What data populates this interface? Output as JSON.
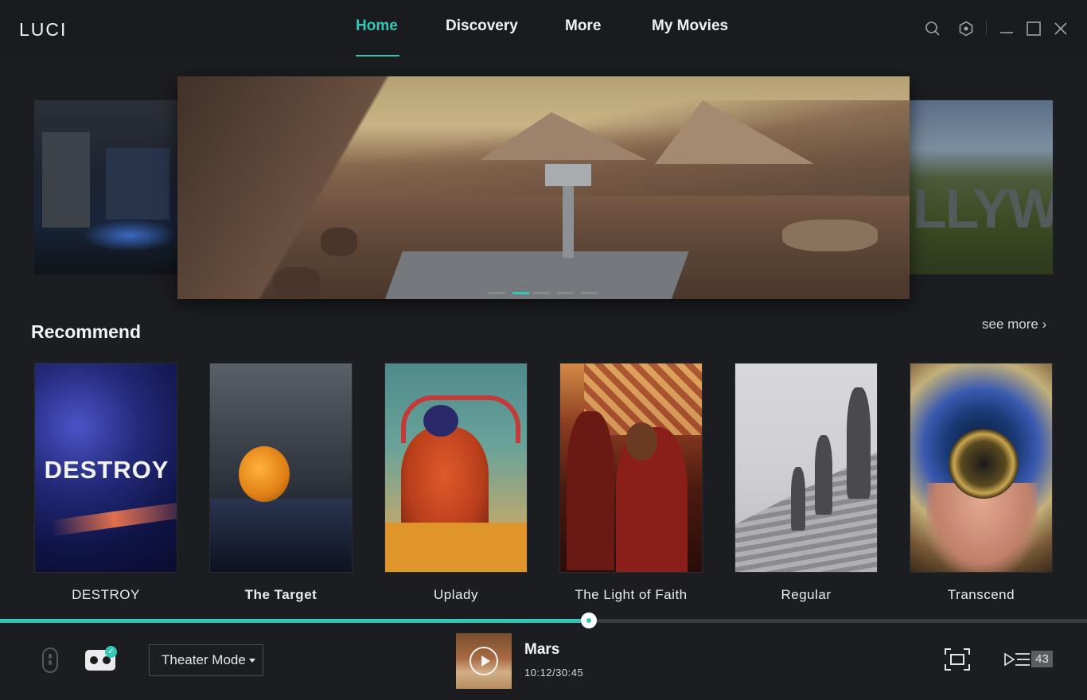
{
  "app": {
    "title": "LUCI"
  },
  "nav": {
    "items": [
      {
        "label": "Home",
        "active": true
      },
      {
        "label": "Discovery",
        "active": false
      },
      {
        "label": "More",
        "active": false
      },
      {
        "label": "My Movies",
        "active": false
      }
    ]
  },
  "window_controls": [
    "search-icon",
    "settings-icon",
    "minimize-icon",
    "maximize-icon",
    "close-icon"
  ],
  "carousel": {
    "slide_count": 5,
    "active_index": 1
  },
  "recommend": {
    "title": "Recommend",
    "see_more": "see more ›",
    "items": [
      {
        "title": "DESTROY",
        "poster_text": "DESTROY"
      },
      {
        "title": "The Target"
      },
      {
        "title": "Uplady"
      },
      {
        "title": "The Light of Faith"
      },
      {
        "title": "Regular"
      },
      {
        "title": "Transcend"
      }
    ]
  },
  "player": {
    "progress_fraction": 0.5417,
    "mode": "Theater Mode",
    "now_playing_title": "Mars",
    "now_playing_time": "10:12/30:45",
    "playlist_count": "43"
  },
  "colors": {
    "accent": "#35c7b6",
    "background": "#1c1d21",
    "topbar": "#1a1b1f"
  }
}
